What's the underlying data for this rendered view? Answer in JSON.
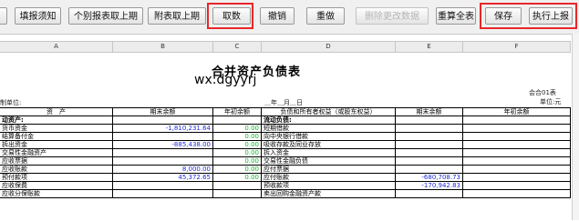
{
  "toolbar": {
    "buttons": [
      {
        "label": "填报须知",
        "enabled": true
      },
      {
        "label": "个别报表取上期",
        "enabled": true
      },
      {
        "label": "附表取上期",
        "enabled": true
      },
      {
        "label": "取数",
        "enabled": true
      },
      {
        "label": "撤销",
        "enabled": true
      },
      {
        "label": "重做",
        "enabled": true
      },
      {
        "label": "删除更改数据",
        "enabled": false
      },
      {
        "label": "重算全表",
        "enabled": true
      },
      {
        "label": "保存",
        "enabled": true
      },
      {
        "label": "执行上报",
        "enabled": true
      }
    ],
    "highlight_color": "#e8262a"
  },
  "columns": [
    "A",
    "B",
    "C",
    "D",
    "E",
    "F"
  ],
  "report": {
    "title": "合并资产负债表",
    "watermark": "wx:dgyyrj",
    "form_code": "会合01表",
    "unit": "单位:元",
    "org_label": "制单位:",
    "date_label": "＿年＿月＿日"
  },
  "table": {
    "headers": [
      "资　产",
      "期末余额",
      "年初余额",
      "负债和所有者权益（或股东权益）",
      "期末余额",
      "年初余额"
    ],
    "rows": [
      [
        "动资产:",
        "",
        "",
        "流动负债:",
        "",
        ""
      ],
      [
        "货币资金",
        "-1,810,231.64",
        "0.00",
        "短期借款",
        "",
        ""
      ],
      [
        "结算备付金",
        "",
        "0.00",
        "向中央银行借款",
        "",
        ""
      ],
      [
        "拆出资金",
        "-885,438.00",
        "0.00",
        "吸收存款及同业存放",
        "",
        ""
      ],
      [
        "交易性金融资产",
        "",
        "0.00",
        "拆入资金",
        "",
        ""
      ],
      [
        "应收票据",
        "",
        "0.00",
        "交易性金融负债",
        "",
        ""
      ],
      [
        "应收账款",
        "8,000.00",
        "0.00",
        "应付票据",
        "",
        ""
      ],
      [
        "预付款项",
        "45,372.65",
        "0.00",
        "应付账款",
        "-680,708.73",
        ""
      ],
      [
        "应收保费",
        "",
        "",
        "预收款项",
        "-170,942.83",
        ""
      ],
      [
        "应收分保账款",
        "",
        "",
        "卖出回购金融资产款",
        "",
        ""
      ]
    ],
    "colors": {
      "amount": "#1f2bd6",
      "zero": "#18b02f"
    }
  }
}
